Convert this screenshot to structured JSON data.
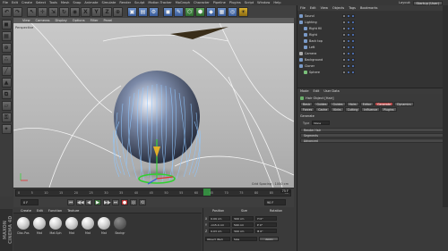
{
  "menubar": {
    "items": [
      "File",
      "Edit",
      "Create",
      "Select",
      "Tools",
      "Mesh",
      "Snap",
      "Animate",
      "Simulate",
      "Render",
      "Sculpt",
      "Motion Tracker",
      "MoGraph",
      "Character",
      "Pipeline",
      "Plugins",
      "Script",
      "Window",
      "Help"
    ],
    "layout_label": "Layout:",
    "layout_value": "Startup (User)"
  },
  "toolbar": {
    "buttons": [
      {
        "glyph": "↶",
        "name": "undo"
      },
      {
        "glyph": "↷",
        "name": "redo"
      },
      {
        "glyph": "↖",
        "name": "live-selection"
      },
      {
        "glyph": "✛",
        "name": "move"
      },
      {
        "glyph": "⇲",
        "name": "scale"
      },
      {
        "glyph": "↻",
        "name": "rotate"
      },
      {
        "glyph": "◉",
        "name": "recent-object"
      },
      {
        "glyph": "X",
        "name": "x-axis"
      },
      {
        "glyph": "Y",
        "name": "y-axis"
      },
      {
        "glyph": "Z",
        "name": "z-axis"
      },
      {
        "glyph": "⊕",
        "name": "coordinate-system"
      },
      {
        "glyph": "▣",
        "name": "render-view"
      },
      {
        "glyph": "▤",
        "name": "render-to-picture-viewer"
      },
      {
        "glyph": "⚙",
        "name": "render-settings"
      },
      {
        "glyph": "◼",
        "name": "cube"
      },
      {
        "glyph": "✎",
        "name": "pen"
      },
      {
        "glyph": "⬡",
        "name": "subdivision-surface"
      },
      {
        "glyph": "⬢",
        "name": "array"
      },
      {
        "glyph": "◆",
        "name": "deformer"
      },
      {
        "glyph": "▦",
        "name": "floor"
      },
      {
        "glyph": "◎",
        "name": "camera"
      },
      {
        "glyph": "☀",
        "name": "light"
      }
    ]
  },
  "viewport": {
    "menu": [
      "View",
      "Cameras",
      "Display",
      "Options",
      "Filter",
      "Panel"
    ],
    "label": "Perspective",
    "grid_spacing": "Grid Spacing : 1000 cm"
  },
  "timeline": {
    "ticks": [
      "0",
      "5",
      "10",
      "15",
      "20",
      "25",
      "30",
      "35",
      "40",
      "45",
      "50",
      "55",
      "60",
      "65",
      "70",
      "75",
      "80",
      "85",
      "90"
    ],
    "current_frame": "75 F",
    "start_field": "0 F",
    "end_field": "90 F",
    "transport": [
      "⏮",
      "◀◀",
      "◀",
      "▶",
      "▶▶",
      "⏭",
      "●",
      "◎",
      "⟲"
    ]
  },
  "materials": {
    "menu": [
      "Create",
      "Edit",
      "Function",
      "Texture"
    ],
    "items": [
      "Disc.Pos",
      "Mat",
      "Mat.Sph",
      "Mat",
      "Mat",
      "Mat",
      "Backgr"
    ]
  },
  "brand": "MAXON CINEMA 4D",
  "coords": {
    "headers": [
      "Position",
      "Size",
      "Rotation"
    ],
    "rows": [
      {
        "axis": "X",
        "pos": "0.09 cm",
        "size": "500 cm",
        "rot": "H 0°"
      },
      {
        "axis": "Y",
        "pos": "-115.4 cm",
        "size": "500 cm",
        "rot": "P 0°"
      },
      {
        "axis": "Z",
        "pos": "0.03 cm",
        "size": "500 cm",
        "rot": "B 0°"
      }
    ],
    "mode": "Object (Rel)",
    "size_mode": "Size",
    "apply": "Apply"
  },
  "objects": {
    "menu": [
      "File",
      "Edit",
      "View",
      "Objects",
      "Tags",
      "Bookmarks"
    ],
    "items": [
      {
        "name": "Sound",
        "indent": 0
      },
      {
        "name": "Lighting",
        "indent": 0
      },
      {
        "name": "Right fill",
        "indent": 1
      },
      {
        "name": "Right",
        "indent": 1
      },
      {
        "name": "Back top",
        "indent": 1
      },
      {
        "name": "Left",
        "indent": 1
      },
      {
        "name": "Camera",
        "indent": 0
      },
      {
        "name": "Background",
        "indent": 0
      },
      {
        "name": "Cloner",
        "indent": 0
      },
      {
        "name": "Sphere",
        "indent": 1
      }
    ]
  },
  "attributes": {
    "menu": [
      "Mode",
      "Edit",
      "User Data"
    ],
    "title": "Hair Object [Hair]",
    "tabs_row1": [
      "Basic",
      "Guides",
      "Guides",
      "Hairs",
      "Editor",
      "Generate",
      "Dynamics"
    ],
    "tabs_row2": [
      "Forces",
      "Cache",
      "Kinks",
      "Cutting",
      "Influence",
      "Plugins"
    ],
    "active_tab": "Generate",
    "section_label": "Generate",
    "field1_label": "Type",
    "field1_value": "None",
    "sections": [
      "Render Hair",
      "Segments",
      "Advanced"
    ]
  }
}
